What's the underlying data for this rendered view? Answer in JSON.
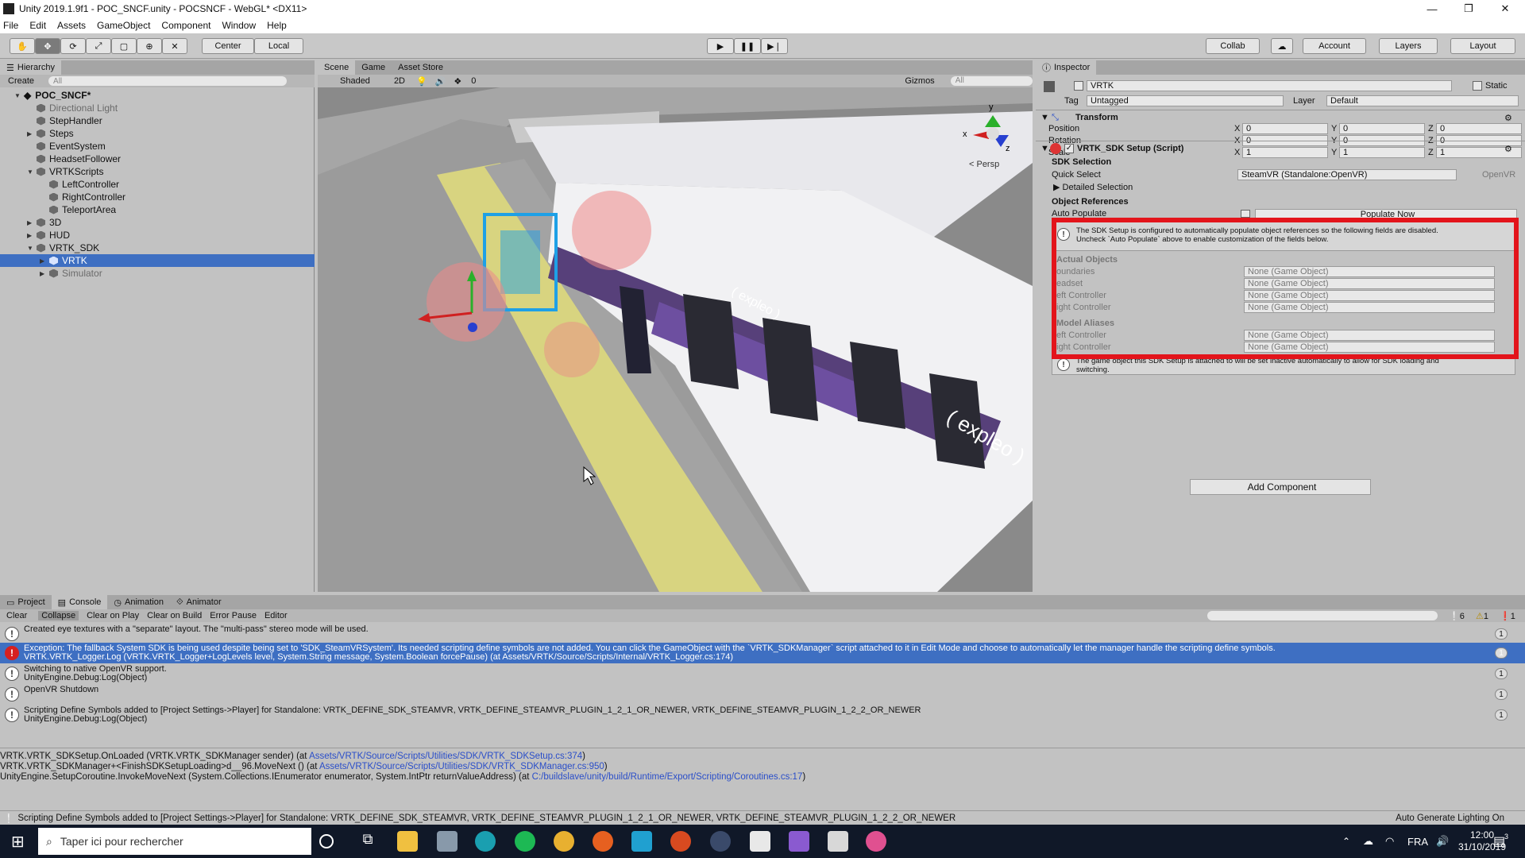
{
  "window": {
    "title": "Unity 2019.1.9f1 - POC_SNCF.unity - POCSNCF - WebGL* <DX11>",
    "minimize": "—",
    "maximize": "❐",
    "close": "✕"
  },
  "menu": [
    "File",
    "Edit",
    "Assets",
    "GameObject",
    "Component",
    "Window",
    "Help"
  ],
  "toolbar": {
    "pivot": "Center",
    "space": "Local",
    "collab": "Collab",
    "account": "Account",
    "layers": "Layers",
    "layout": "Layout"
  },
  "hierarchy": {
    "tab": "Hierarchy",
    "create": "Create",
    "search_placeholder": "All",
    "scene": "POC_SNCF*",
    "items": [
      {
        "label": "Directional Light",
        "depth": 1,
        "arrow": "",
        "dim": true
      },
      {
        "label": "StepHandler",
        "depth": 1,
        "arrow": ""
      },
      {
        "label": "Steps",
        "depth": 1,
        "arrow": "▶"
      },
      {
        "label": "EventSystem",
        "depth": 1,
        "arrow": ""
      },
      {
        "label": "HeadsetFollower",
        "depth": 1,
        "arrow": ""
      },
      {
        "label": "VRTKScripts",
        "depth": 1,
        "arrow": "▼"
      },
      {
        "label": "LeftController",
        "depth": 2,
        "arrow": ""
      },
      {
        "label": "RightController",
        "depth": 2,
        "arrow": ""
      },
      {
        "label": "TeleportArea",
        "depth": 2,
        "arrow": ""
      },
      {
        "label": "3D",
        "depth": 1,
        "arrow": "▶"
      },
      {
        "label": "HUD",
        "depth": 1,
        "arrow": "▶"
      },
      {
        "label": "VRTK_SDK",
        "depth": 1,
        "arrow": "▼"
      },
      {
        "label": "VRTK",
        "depth": 2,
        "arrow": "▶",
        "selected": true
      },
      {
        "label": "Simulator",
        "depth": 2,
        "arrow": "▶",
        "dim": true
      }
    ]
  },
  "scene": {
    "tabs": [
      "Scene",
      "Game",
      "Asset Store"
    ],
    "shading": "Shaded",
    "mode2d": "2D",
    "fx_count": "0",
    "gizmos": "Gizmos",
    "search": "All",
    "persp": "< Persp",
    "axis_y": "y",
    "axis_x": "x",
    "axis_z": "z",
    "train_text_1": "( expleo )",
    "train_text_2": "( expleo )",
    "train_text_3": "( expleo )"
  },
  "inspector": {
    "tab": "Inspector",
    "object_name": "VRTK",
    "static_label": "Static",
    "tag_label": "Tag",
    "tag_value": "Untagged",
    "layer_label": "Layer",
    "layer_value": "Default",
    "transform": {
      "title": "Transform",
      "rows": [
        {
          "label": "Position",
          "x": "0",
          "y": "0",
          "z": "0"
        },
        {
          "label": "Rotation",
          "x": "0",
          "y": "0",
          "z": "0"
        },
        {
          "label": "Scale",
          "x": "1",
          "y": "1",
          "z": "1"
        }
      ]
    },
    "script": {
      "title": "VRTK_SDK Setup (Script)",
      "sdk_selection": "SDK Selection",
      "quick_select_label": "Quick Select",
      "quick_select_value": "SteamVR (Standalone:OpenVR)",
      "quick_select_suffix": "OpenVR",
      "detailed": "Detailed Selection",
      "object_references": "Object References",
      "auto_populate": "Auto Populate",
      "populate_now": "Populate Now",
      "info_text_1": "The SDK Setup is configured to automatically populate object references so the following fields are disabled.",
      "info_text_2": "Uncheck `Auto Populate` above to enable customization of the fields below.",
      "actual_objects": "Actual Objects",
      "actual_rows": [
        {
          "label": "oundaries",
          "value": "None (Game Object)"
        },
        {
          "label": "eadset",
          "value": "None (Game Object)"
        },
        {
          "label": "eft Controller",
          "value": "None (Game Object)"
        },
        {
          "label": "ight Controller",
          "value": "None (Game Object)"
        }
      ],
      "model_aliases": "Model Aliases",
      "alias_rows": [
        {
          "label": "eft Controller",
          "value": "None (Game Object)"
        },
        {
          "label": "ight Controller",
          "value": "None (Game Object)"
        }
      ],
      "bottom_info_1": "The game object this SDK Setup is attached to will be set inactive automatically to allow for SDK loading and",
      "bottom_info_2": "switching."
    },
    "add_component": "Add Component",
    "highlight_color": "#e3141b"
  },
  "console": {
    "tabs": [
      "Project",
      "Console",
      "Animation",
      "Animator"
    ],
    "buttons": [
      "Clear",
      "Collapse",
      "Clear on Play",
      "Clear on Build",
      "Error Pause",
      "Editor"
    ],
    "counts": {
      "info": "6",
      "warn": "1",
      "error": "1"
    },
    "messages": [
      {
        "type": "info",
        "line1": "Created eye textures with a \"separate\" layout.  The \"multi-pass\" stereo mode will be used.",
        "line2": "",
        "count": "1"
      },
      {
        "type": "err",
        "line1": "Exception: The fallback System SDK is being used despite being set to 'SDK_SteamVRSystem'. Its needed scripting define symbols are not added. You can click the GameObject with the `VRTK_SDKManager` script attached to it in Edit Mode and choose to automatically let the manager handle the scripting define symbols.",
        "line2": "VRTK.VRTK_Logger.Log (VRTK.VRTK_Logger+LogLevels level, System.String message, System.Boolean forcePause) (at Assets/VRTK/Source/Scripts/Internal/VRTK_Logger.cs:174)",
        "count": "1",
        "selected": true
      },
      {
        "type": "info",
        "line1": "Switching to native OpenVR support.",
        "line2": "UnityEngine.Debug:Log(Object)",
        "count": "1"
      },
      {
        "type": "info",
        "line1": "OpenVR Shutdown",
        "line2": "",
        "count": "1"
      },
      {
        "type": "info",
        "line1": "Scripting Define Symbols added to [Project Settings->Player] for Standalone: VRTK_DEFINE_SDK_STEAMVR, VRTK_DEFINE_STEAMVR_PLUGIN_1_2_1_OR_NEWER, VRTK_DEFINE_STEAMVR_PLUGIN_1_2_2_OR_NEWER",
        "line2": "UnityEngine.Debug:Log(Object)",
        "count": "1"
      }
    ],
    "stack": [
      {
        "pre": "VRTK.VRTK_SDKSetup.OnLoaded (VRTK.VRTK_SDKManager sender) (at ",
        "link": "Assets/VRTK/Source/Scripts/Utilities/SDK/VRTK_SDKSetup.cs:374",
        "post": ")"
      },
      {
        "pre": "VRTK.VRTK_SDKManager+<FinishSDKSetupLoading>d__96.MoveNext () (at ",
        "link": "Assets/VRTK/Source/Scripts/Utilities/SDK/VRTK_SDKManager.cs:950",
        "post": ")"
      },
      {
        "pre": "UnityEngine.SetupCoroutine.InvokeMoveNext (System.Collections.IEnumerator enumerator, System.IntPtr returnValueAddress) (at ",
        "link": "C:/buildslave/unity/build/Runtime/Export/Scripting/Coroutines.cs:17",
        "post": ")"
      }
    ]
  },
  "status": {
    "message": "Scripting Define Symbols added to [Project Settings->Player] for Standalone: VRTK_DEFINE_SDK_STEAMVR, VRTK_DEFINE_STEAMVR_PLUGIN_1_2_1_OR_NEWER, VRTK_DEFINE_STEAMVR_PLUGIN_1_2_2_OR_NEWER",
    "right": "Auto Generate Lighting On"
  },
  "taskbar": {
    "search_placeholder": "Taper ici pour rechercher",
    "lang": "FRA",
    "time": "12:00",
    "date": "31/10/2019",
    "notif": "3"
  }
}
